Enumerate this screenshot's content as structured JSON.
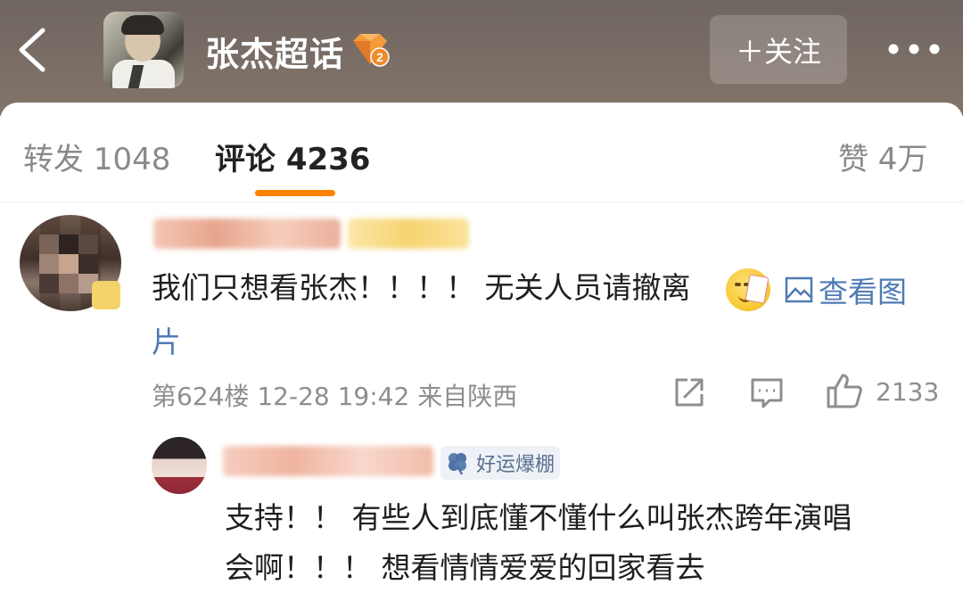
{
  "header": {
    "title": "张杰超话",
    "rank_badge": "2",
    "follow_label": "＋关注",
    "icons": {
      "back": "back-arrow-icon",
      "rank": "diamond-rank-icon",
      "more": "more-dots-icon"
    }
  },
  "tabs": [
    {
      "label": "转发 1048",
      "active": false
    },
    {
      "label": "评论 4236",
      "active": true
    },
    {
      "label": "赞 4万",
      "active": false
    }
  ],
  "colors": {
    "accent": "#ff8200",
    "link": "#4f7bb5",
    "header_bg": "#7a6e66",
    "meta": "#8e8e8e"
  },
  "comment": {
    "text_line1": "我们只想看张杰！！！！ 无关人员请撤离",
    "view_image_label": "查看图",
    "text_line2": "片",
    "meta": "第624楼  12-28 19:42  来自陕西",
    "like_count": "2133",
    "icons": {
      "share": "share-icon",
      "reply": "comment-icon",
      "like": "thumbs-up-icon",
      "image": "image-icon",
      "emoji": "emoji-icon"
    }
  },
  "reply": {
    "badge_label": "好运爆棚",
    "text_line1": "支持！！ 有些人到底懂不懂什么叫张杰跨年演唱",
    "text_line2": "会啊！！！ 想看情情爱爱的回家看去",
    "icons": {
      "badge": "clover-icon"
    }
  }
}
